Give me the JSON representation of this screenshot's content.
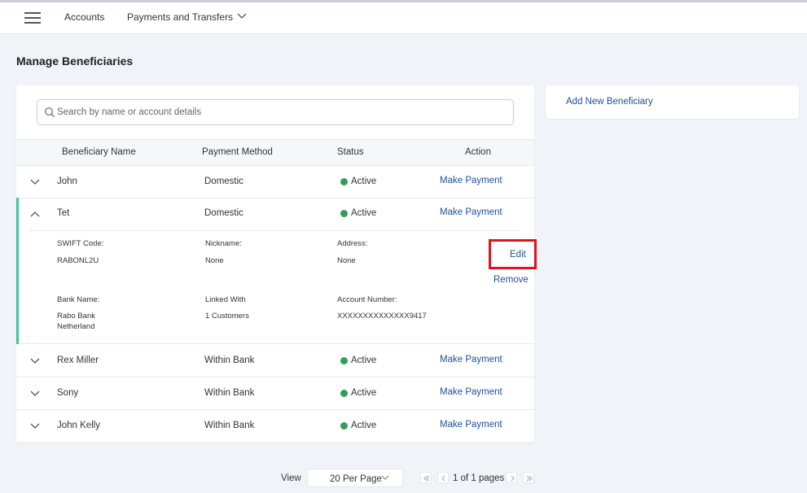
{
  "topbar": {
    "nav": [
      "Accounts",
      "Payments and Transfers"
    ]
  },
  "page_title": "Manage Beneficiaries",
  "search": {
    "placeholder": "Search by name or account details"
  },
  "table": {
    "headers": [
      "Beneficiary Name",
      "Payment Method",
      "Status",
      "Action"
    ],
    "rows": [
      {
        "name": "John",
        "method": "Domestic",
        "status": "Active",
        "action": "Make Payment"
      },
      {
        "name": "Tet",
        "method": "Domestic",
        "status": "Active",
        "action": "Make Payment"
      },
      {
        "name": "Rex Miller",
        "method": "Within Bank",
        "status": "Active",
        "action": "Make Payment"
      },
      {
        "name": "Sony",
        "method": "Within Bank",
        "status": "Active",
        "action": "Make Payment"
      },
      {
        "name": "John Kelly",
        "method": "Within Bank",
        "status": "Active",
        "action": "Make Payment"
      }
    ]
  },
  "details": {
    "swift_label": "SWIFT Code:",
    "swift_value": "RABONL2U",
    "nickname_label": "Nickname:",
    "nickname_value": "None",
    "address_label": "Address:",
    "address_value": "None",
    "bank_label": "Bank Name:",
    "bank_value": "Rabo Bank\nNetherland",
    "linked_label": "Linked With",
    "linked_value": "1 Customers",
    "account_label": "Account Number:",
    "account_value": "XXXXXXXXXXXXXX9417",
    "edit": "Edit",
    "remove": "Remove"
  },
  "side": {
    "add_new": "Add New Beneficiary"
  },
  "pager": {
    "view_label": "View",
    "per_page": "20 Per Page",
    "page_info": "1 of 1 pages"
  },
  "colors": {
    "link": "#1d4f9e",
    "active_dot": "#2e9e5b",
    "accent": "#3cc79a",
    "highlight": "#e3111f"
  }
}
